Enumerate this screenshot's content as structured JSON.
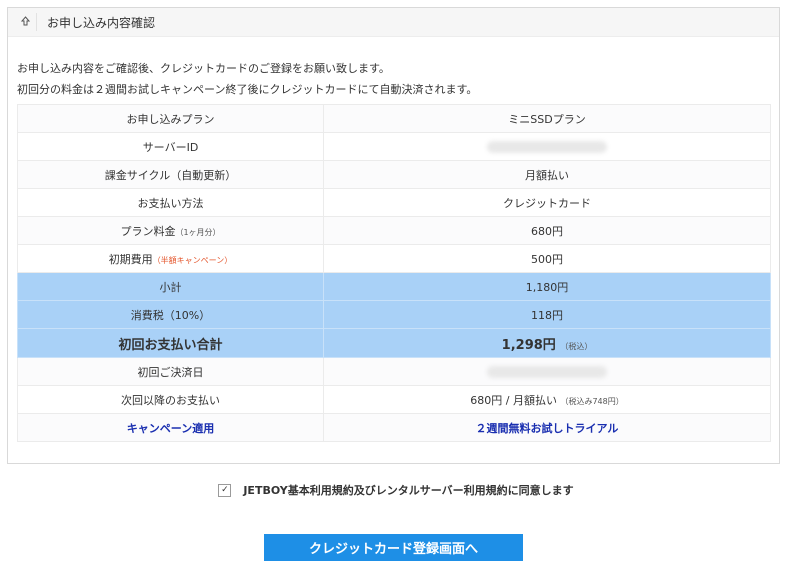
{
  "header": {
    "title": "お申し込み内容確認",
    "icon": "arrow-up-icon"
  },
  "intro": {
    "line1": "お申し込み内容をご確認後、クレジットカードのご登録をお願い致します。",
    "line2": "初回分の料金は２週間お試しキャンペーン終了後にクレジットカードにて自動決済されます。"
  },
  "rows": {
    "plan": {
      "label": "お申し込みプラン",
      "value": "ミニSSDプラン"
    },
    "server_id": {
      "label": "サーバーID",
      "value": ""
    },
    "billing_cycle": {
      "label": "課金サイクル（自動更新）",
      "value": "月額払い"
    },
    "payment_method": {
      "label": "お支払い方法",
      "value": "クレジットカード"
    },
    "plan_fee": {
      "label": "プラン料金",
      "label_note": "（1ヶ月分）",
      "value": "680円"
    },
    "initial_fee": {
      "label": "初期費用",
      "label_note": "（半額キャンペーン）",
      "value": "500円"
    },
    "subtotal": {
      "label": "小計",
      "value": "1,180円"
    },
    "tax": {
      "label": "消費税（10%）",
      "value": "118円"
    },
    "total": {
      "label": "初回お支払い合計",
      "value": "1,298円",
      "value_note": "（税込）"
    },
    "first_payment_date": {
      "label": "初回ご決済日",
      "value": ""
    },
    "next_payment": {
      "label": "次回以降のお支払い",
      "value": "680円 / 月額払い",
      "value_note": "（税込み748円）"
    },
    "campaign": {
      "label": "キャンペーン適用",
      "value": "２週間無料お試しトライアル"
    }
  },
  "agreement": {
    "text": "JETBOY基本利用規約及びレンタルサーバー利用規約に同意します",
    "checked": true,
    "check_mark": "✓"
  },
  "submit": {
    "label": "クレジットカード登録画面へ"
  },
  "colors": {
    "highlight_row": "#a9d1f7",
    "button": "#1e8fe6",
    "campaign_text": "#e4572e",
    "link_blue": "#1a2fb0"
  }
}
